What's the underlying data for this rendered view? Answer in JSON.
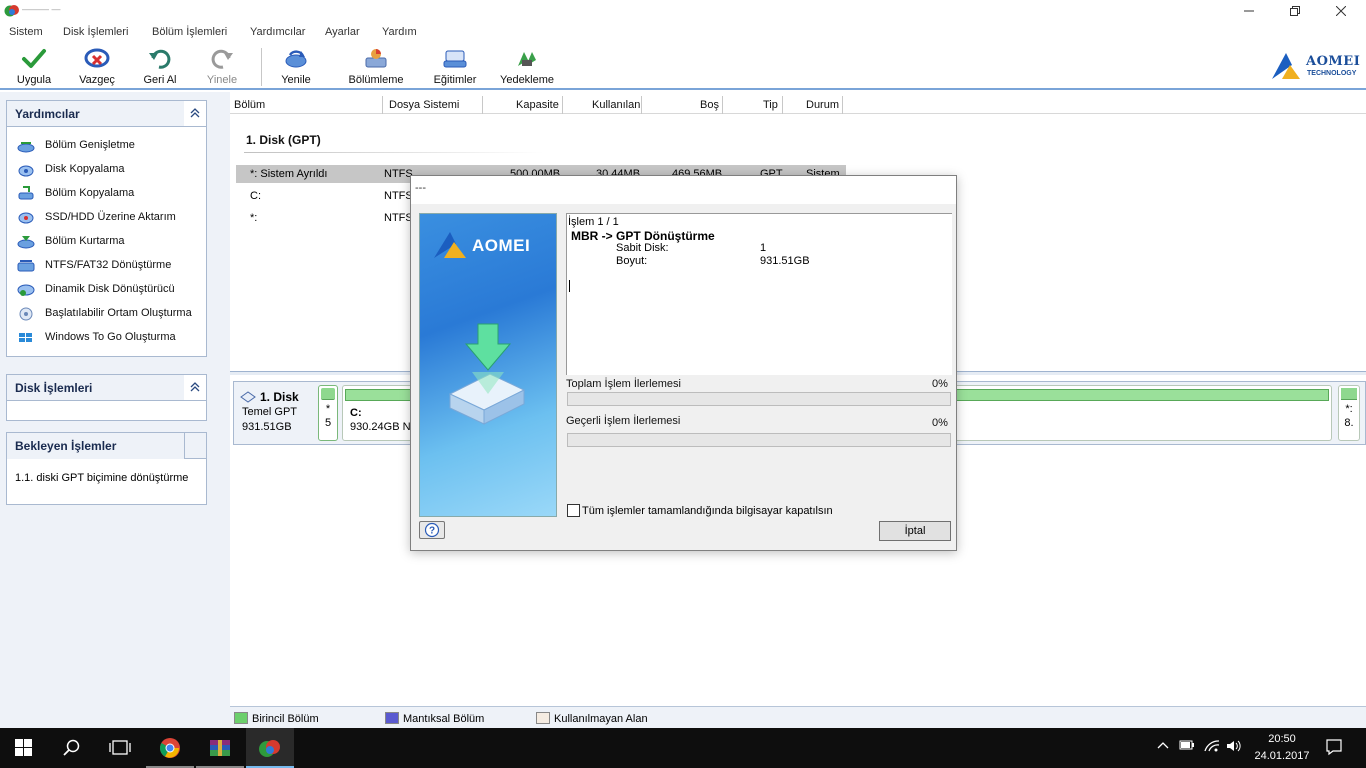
{
  "window": {
    "title": "——— —",
    "minimize_icon": "minimize-icon",
    "maximize_icon": "restore-icon",
    "close_icon": "close-icon"
  },
  "menu": [
    "Sistem",
    "Disk İşlemleri",
    "Bölüm İşlemleri",
    "Yardımcılar",
    "Ayarlar",
    "Yardım"
  ],
  "toolbar": {
    "apply": "Uygula",
    "discard": "Vazgeç",
    "undo": "Geri Al",
    "redo": "Yinele",
    "refresh": "Yenile",
    "partition": "Bölümleme",
    "tutorials": "Eğitimler",
    "backup": "Yedekleme",
    "brand_name": "AOMEI",
    "brand_sub": "TECHNOLOGY"
  },
  "sidebar": {
    "wizards_title": "Yardımcılar",
    "wizards": [
      "Bölüm Genişletme",
      "Disk Kopyalama",
      "Bölüm Kopyalama",
      "SSD/HDD Üzerine Aktarım",
      "Bölüm Kurtarma",
      "NTFS/FAT32 Dönüştürme",
      "Dinamik Disk Dönüştürücü",
      "Başlatılabilir Ortam Oluşturma",
      "Windows To Go Oluşturma"
    ],
    "disk_ops_title": "Disk İşlemleri",
    "pending_title": "Bekleyen İşlemler",
    "pending_items": [
      "1.1. diski GPT biçimine dönüştürme"
    ]
  },
  "table": {
    "columns": [
      "Bölüm",
      "Dosya Sistemi",
      "Kapasite",
      "Kullanılan",
      "Boş",
      "Tip",
      "Durum"
    ],
    "disk_title": "1. Disk (GPT)",
    "rows": [
      {
        "name": "*: Sistem Ayrıldı",
        "fs": "NTFS",
        "capacity": "500.00MB",
        "used": "30.44MB",
        "free": "469.56MB",
        "type": "GPT",
        "status": "Sistem"
      },
      {
        "name": "C:",
        "fs": "NTFS",
        "capacity": "",
        "used": "",
        "free": "",
        "type": "",
        "status": ""
      },
      {
        "name": "*:",
        "fs": "NTFS",
        "capacity": "",
        "used": "",
        "free": "",
        "type": "",
        "status": ""
      }
    ]
  },
  "diskmap": {
    "name": "1. Disk",
    "style": "Temel GPT",
    "size": "931.51GB",
    "small_label_1": "*",
    "small_label_2": "5",
    "main_label": "C:",
    "main_size": "930.24GB NT",
    "right_label_1": "*:",
    "right_label_2": "8."
  },
  "legend": {
    "primary": "Birincil Bölüm",
    "logical": "Mantıksal Bölüm",
    "unallocated": "Kullanılmayan Alan",
    "primary_color": "#6ccf6c",
    "logical_color": "#5a5ad0",
    "unallocated_color": "#f5ece2"
  },
  "dialog": {
    "title": "---",
    "logo_text": "AOMEI",
    "op_counter": "İşlem 1 / 1",
    "op_title": "MBR -> GPT Dönüştürme",
    "disk_label": "Sabit Disk:",
    "disk_value": "1",
    "size_label": "Boyut:",
    "size_value": "931.51GB",
    "total_progress_label": "Toplam İşlem İlerlemesi",
    "total_progress_pct": "0%",
    "total_progress_value": 0,
    "current_progress_label": "Geçerli İşlem İlerlemesi",
    "current_progress_pct": "0%",
    "current_progress_value": 0,
    "shutdown_label": "Tüm işlemler tamamlandığında bilgisayar kapatılsın",
    "shutdown_checked": false,
    "help_icon": "help-icon",
    "cancel_label": "İptal"
  },
  "taskbar": {
    "apps": [
      "windows-start-icon",
      "search-icon",
      "task-view-icon",
      "chrome-icon",
      "winrar-icon",
      "aomei-partition-assistant-icon"
    ],
    "time": "20:50",
    "date": "24.01.2017"
  }
}
